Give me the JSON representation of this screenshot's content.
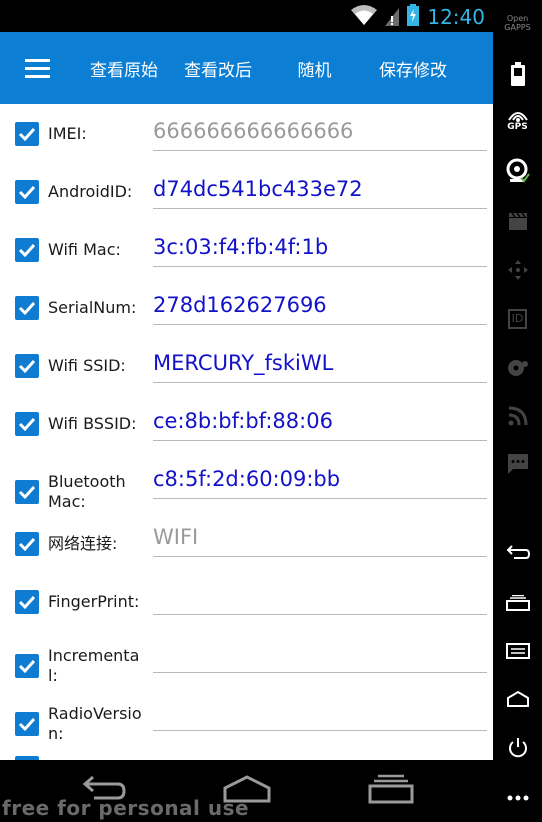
{
  "status_bar": {
    "time": "12:40"
  },
  "toolbar": {
    "menu_icon": "hamburger-menu-icon",
    "buttons": [
      {
        "label": "查看原始"
      },
      {
        "label": "查看改后"
      },
      {
        "label": "随机"
      },
      {
        "label": "保存修改"
      }
    ]
  },
  "fields": [
    {
      "label": "IMEI:",
      "value": "666666666666666",
      "value_style": "gray",
      "checked": true
    },
    {
      "label": "AndroidID:",
      "value": "d74dc541bc433e72",
      "value_style": "blue",
      "checked": true
    },
    {
      "label": "Wifi Mac:",
      "value": "3c:03:f4:fb:4f:1b",
      "value_style": "blue",
      "checked": true
    },
    {
      "label": "SerialNum:",
      "value": "278d162627696",
      "value_style": "blue",
      "checked": true
    },
    {
      "label": "Wifi SSID:",
      "value": "MERCURY_fskiWL",
      "value_style": "blue",
      "checked": true
    },
    {
      "label": "Wifi BSSID:",
      "value": "ce:8b:bf:bf:88:06",
      "value_style": "blue",
      "checked": true
    },
    {
      "label": "Bluetooth Mac:",
      "value": "c8:5f:2d:60:09:bb",
      "value_style": "blue",
      "checked": true
    },
    {
      "label": "网络连接:",
      "value": "WIFI",
      "value_style": "gray",
      "checked": true
    },
    {
      "label": "FingerPrint:",
      "value": "",
      "value_style": "blue",
      "checked": true
    },
    {
      "label": "Incremental:",
      "value": "",
      "value_style": "blue",
      "checked": true
    },
    {
      "label": "RadioVersion:",
      "value": "",
      "value_style": "blue",
      "checked": true
    }
  ],
  "side_bar": {
    "top_label": "Open GAPPS",
    "gps_label": "GPS",
    "id_label": "ID"
  },
  "watermark": "free for personal use",
  "colors": {
    "toolbar": "#0c7fd4",
    "checkbox": "#0f7bd1",
    "value_blue": "#1212c8",
    "value_gray": "#9a9a9a",
    "clock": "#33b5e5"
  }
}
